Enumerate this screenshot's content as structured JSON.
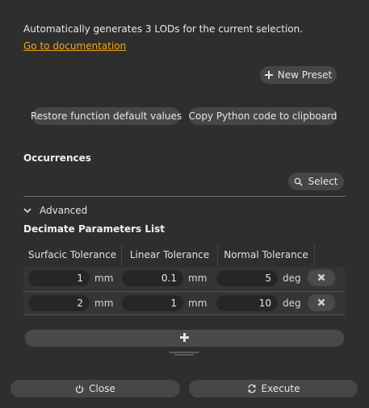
{
  "description": "Automatically generates 3 LODs for the current selection.",
  "doc_link": "Go to documentation",
  "buttons": {
    "new_preset": "New Preset",
    "restore_defaults": "Restore function default values",
    "copy_python": "Copy Python code to clipboard",
    "select": "Select",
    "close": "Close",
    "execute": "Execute"
  },
  "occurrences": {
    "label": "Occurrences"
  },
  "advanced": {
    "label": "Advanced"
  },
  "decimate": {
    "title": "Decimate Parameters List",
    "headers": [
      "Surfacic Tolerance",
      "Linear Tolerance",
      "Normal Tolerance"
    ],
    "rows": [
      {
        "surfacic": "1",
        "surfacic_unit": "mm",
        "linear": "0.1",
        "linear_unit": "mm",
        "normal": "5",
        "normal_unit": "deg"
      },
      {
        "surfacic": "2",
        "surfacic_unit": "mm",
        "linear": "1",
        "linear_unit": "mm",
        "normal": "10",
        "normal_unit": "deg"
      }
    ]
  },
  "colors": {
    "accent_link": "#f0a81c",
    "background": "#2e2e2e",
    "button": "#464646"
  },
  "icons": [
    "plus-icon",
    "search-icon",
    "chevron-down-icon",
    "close-icon",
    "power-icon",
    "refresh-icon",
    "resize-grip-icon"
  ]
}
